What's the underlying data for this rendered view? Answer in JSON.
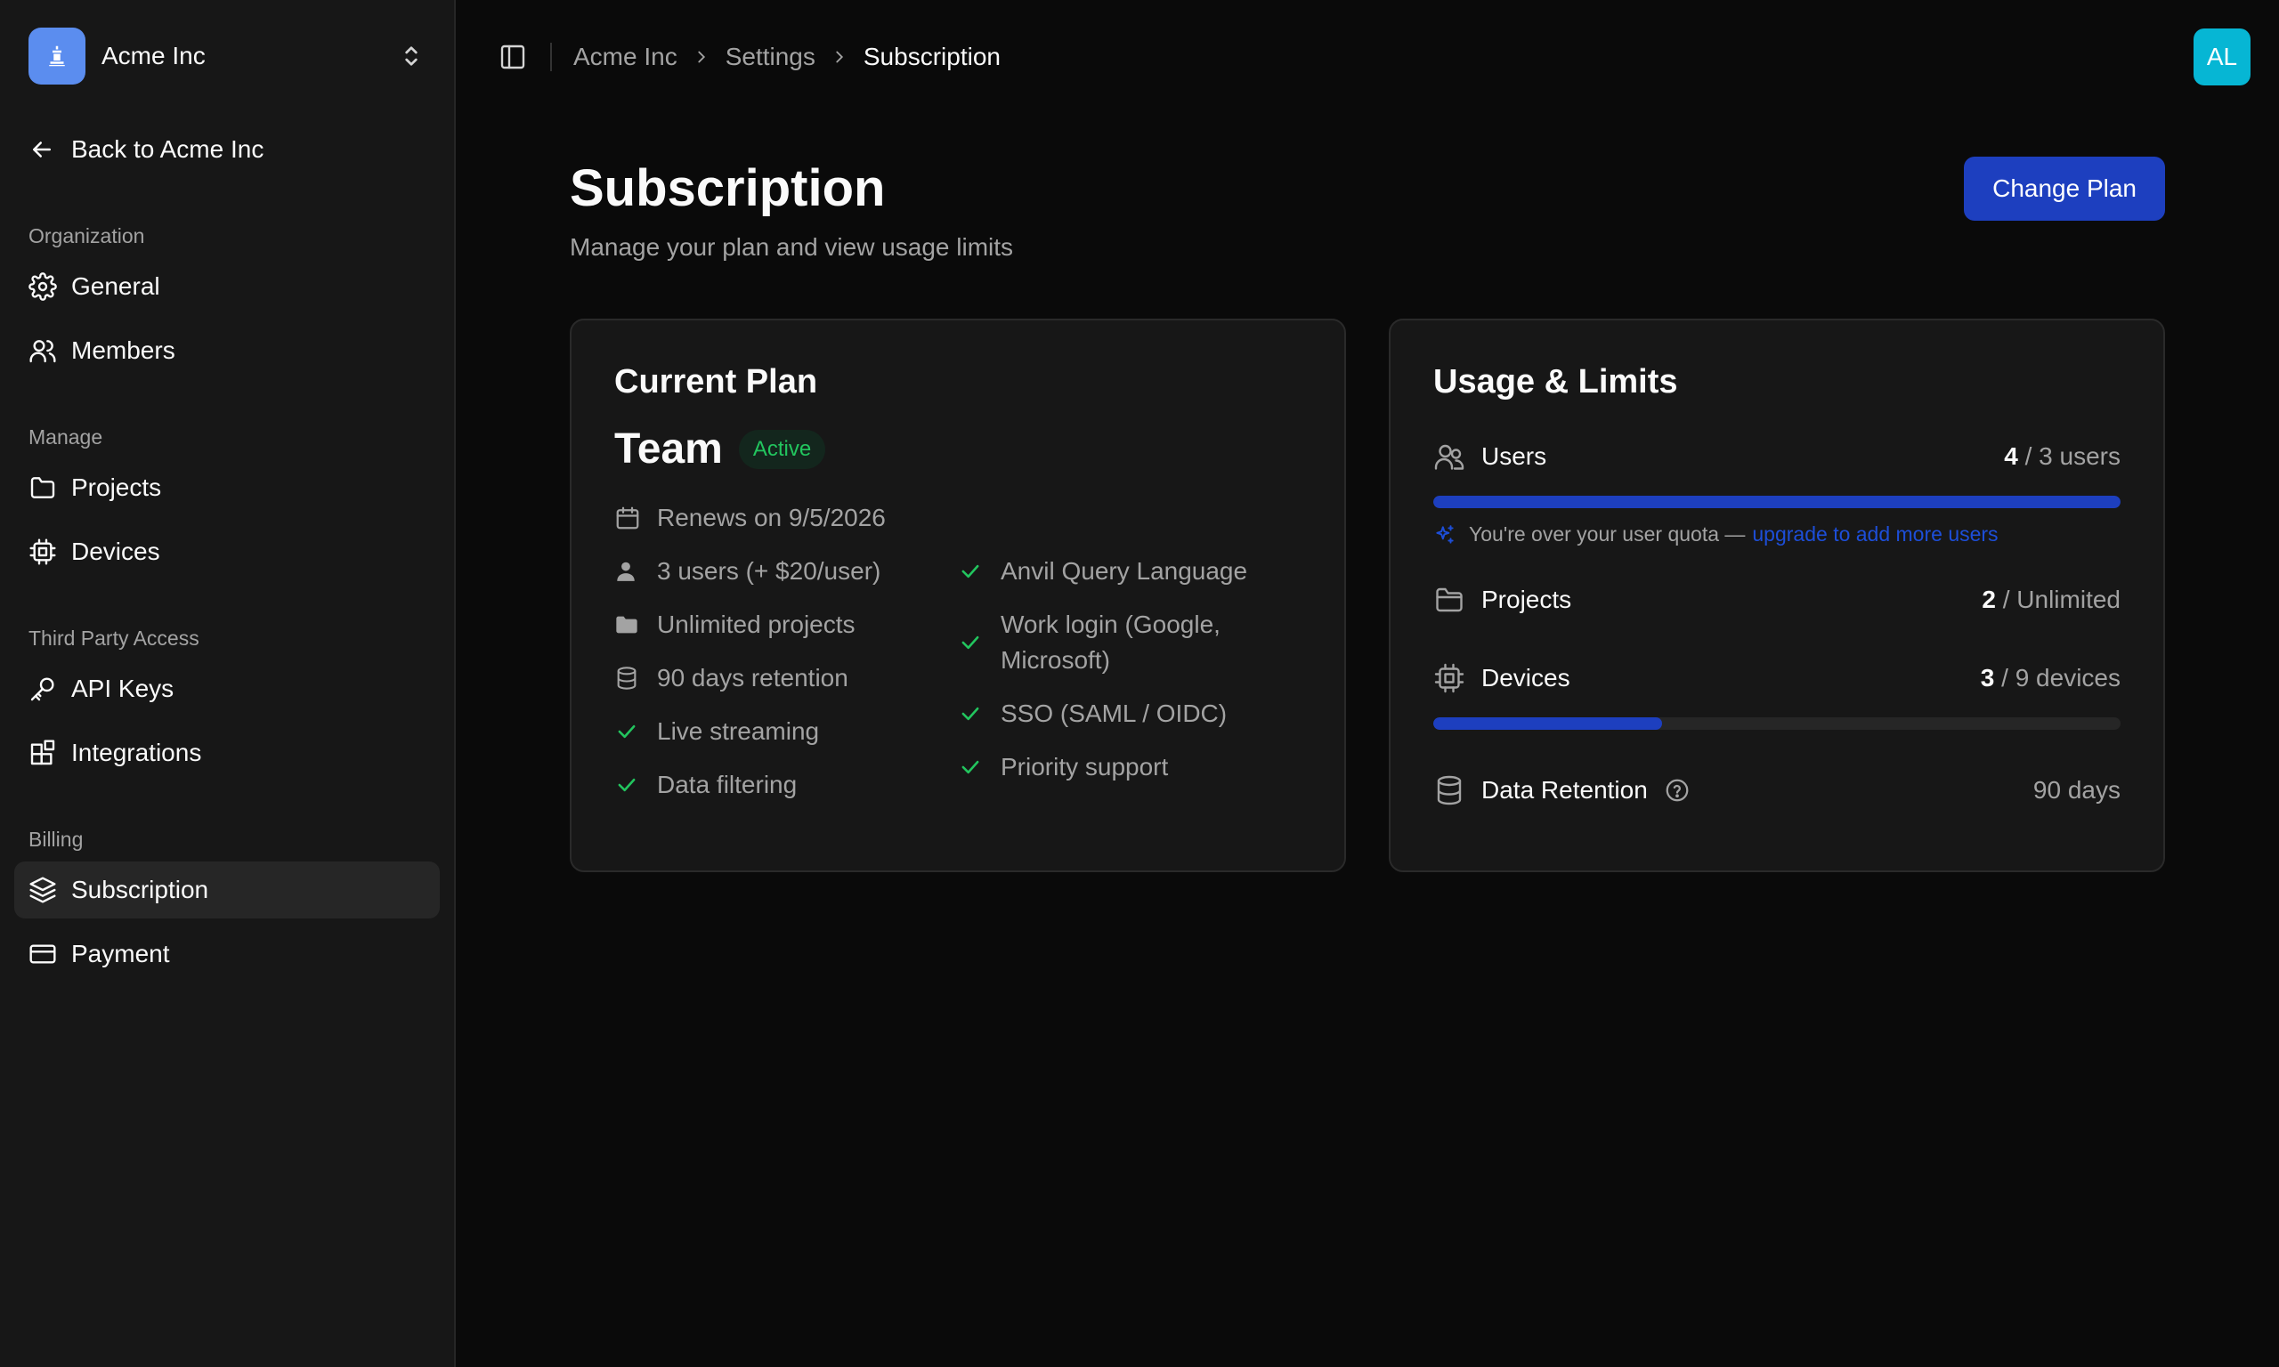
{
  "org": {
    "name": "Acme Inc"
  },
  "sidebar": {
    "back_label": "Back to Acme Inc",
    "sections": [
      {
        "label": "Organization",
        "items": [
          {
            "label": "General",
            "icon": "gear-icon"
          },
          {
            "label": "Members",
            "icon": "users-icon"
          }
        ]
      },
      {
        "label": "Manage",
        "items": [
          {
            "label": "Projects",
            "icon": "folder-icon"
          },
          {
            "label": "Devices",
            "icon": "chip-icon"
          }
        ]
      },
      {
        "label": "Third Party Access",
        "items": [
          {
            "label": "API Keys",
            "icon": "key-icon"
          },
          {
            "label": "Integrations",
            "icon": "blocks-icon"
          }
        ]
      },
      {
        "label": "Billing",
        "items": [
          {
            "label": "Subscription",
            "icon": "layers-icon",
            "active": true
          },
          {
            "label": "Payment",
            "icon": "credit-card-icon"
          }
        ]
      }
    ]
  },
  "breadcrumb": [
    "Acme Inc",
    "Settings",
    "Subscription"
  ],
  "user": {
    "initials": "AL"
  },
  "page": {
    "title": "Subscription",
    "subtitle": "Manage your plan and view usage limits",
    "change_plan_label": "Change Plan"
  },
  "current_plan": {
    "title": "Current Plan",
    "plan_name": "Team",
    "status": "Active",
    "renews": "Renews on 9/5/2026",
    "features_left": [
      "3 users (+ $20/user)",
      "Unlimited projects",
      "90 days retention",
      "Live streaming",
      "Data filtering"
    ],
    "features_right": [
      "Anvil Query Language",
      "Work login (Google, Microsoft)",
      "SSO (SAML / OIDC)",
      "Priority support"
    ]
  },
  "usage": {
    "title": "Usage & Limits",
    "users": {
      "label": "Users",
      "used": "4",
      "limit": "/ 3 users",
      "fill": 1.0
    },
    "quota_note": "You're over your user quota —",
    "quota_link": "upgrade to add more users",
    "projects": {
      "label": "Projects",
      "used": "2",
      "limit": "/ Unlimited"
    },
    "devices": {
      "label": "Devices",
      "used": "3",
      "limit": "/ 9 devices",
      "fill": 0.333
    },
    "retention": {
      "label": "Data Retention",
      "value": "90 days"
    }
  },
  "colors": {
    "accent": "#1d3fbf",
    "success": "#22c55e",
    "avatar": "#06b6d4",
    "org_logo": "#5b8def"
  }
}
